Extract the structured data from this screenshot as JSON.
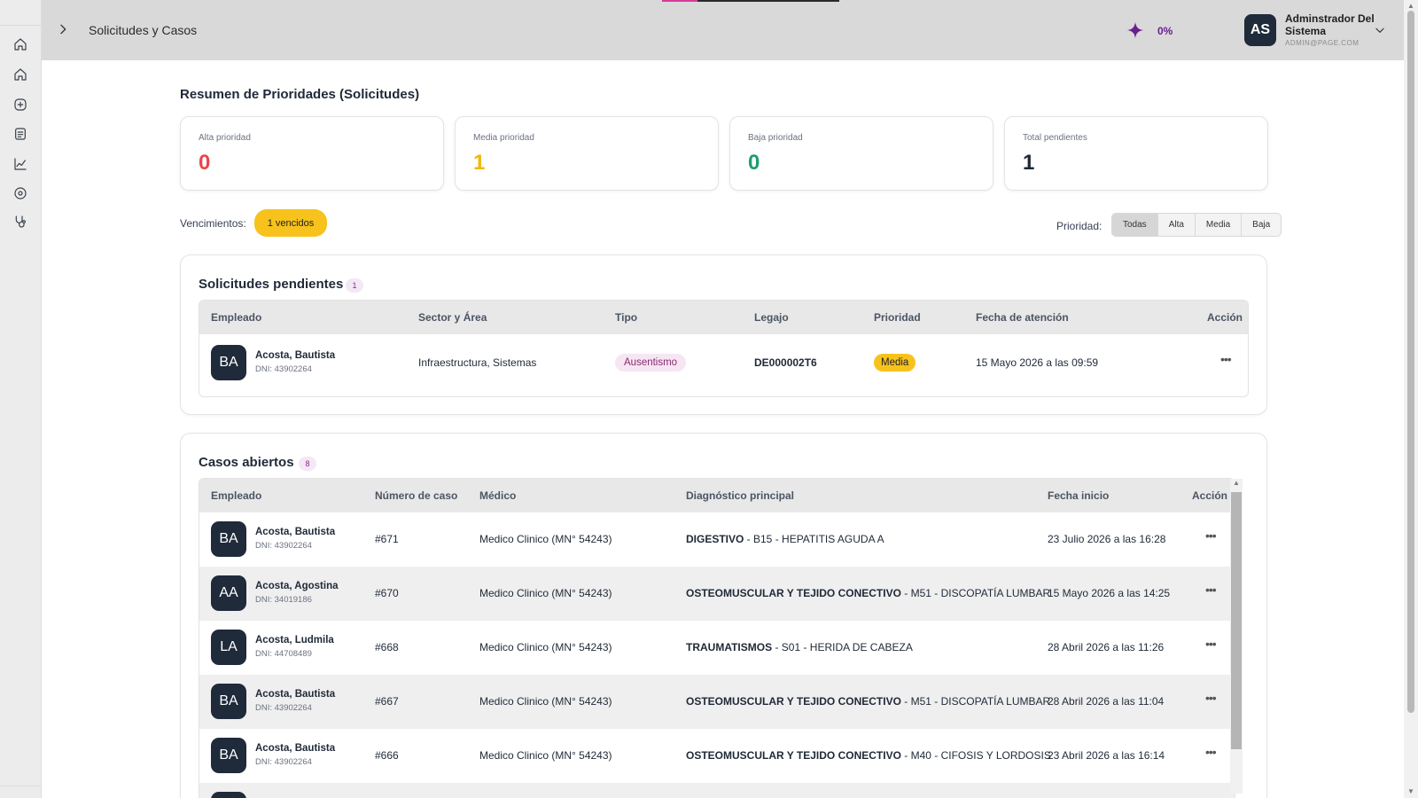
{
  "header": {
    "breadcrumb": "Solicitudes y Casos",
    "progress_percent": "0%",
    "user": {
      "initials": "AS",
      "name": "Adminstrador Del Sistema",
      "email": "ADMIN@PAGE.COM"
    }
  },
  "sidebar": {
    "icons": [
      "home-icon",
      "home-icon",
      "plus-circle-icon",
      "document-icon",
      "chart-icon",
      "target-icon",
      "stethoscope-icon"
    ]
  },
  "summary": {
    "title": "Resumen de Prioridades (Solicitudes)",
    "cards": [
      {
        "label": "Alta prioridad",
        "value": "0",
        "color": "#e8474c"
      },
      {
        "label": "Media prioridad",
        "value": "1",
        "color": "#f2b705"
      },
      {
        "label": "Baja prioridad",
        "value": "0",
        "color": "#1f9d6b"
      },
      {
        "label": "Total pendientes",
        "value": "1",
        "color": "#1f2937"
      }
    ]
  },
  "filters": {
    "vencimientos_label": "Vencimientos:",
    "vencimientos_badge": "1 vencidos",
    "prioridad_label": "Prioridad:",
    "prioridad_options": [
      "Todas",
      "Alta",
      "Media",
      "Baja"
    ],
    "prioridad_selected": "Todas"
  },
  "solicitudes": {
    "title": "Solicitudes pendientes",
    "count": "1",
    "columns": [
      "Empleado",
      "Sector y Área",
      "Tipo",
      "Legajo",
      "Prioridad",
      "Fecha de atención",
      "Acción"
    ],
    "rows": [
      {
        "initials": "BA",
        "name": "Acosta, Bautista",
        "dni": "DNI: 43902264",
        "sector": "Infraestructura, Sistemas",
        "tipo": "Ausentismo",
        "legajo": "DE000002T6",
        "prioridad": "Media",
        "fecha": "15 Mayo 2026 a las 09:59",
        "accion": "•••"
      }
    ]
  },
  "casos": {
    "title": "Casos abiertos",
    "count": "8",
    "columns": [
      "Empleado",
      "Número de caso",
      "Médico",
      "Diagnóstico principal",
      "Fecha inicio",
      "Acción"
    ],
    "rows": [
      {
        "initials": "BA",
        "name": "Acosta, Bautista",
        "dni": "DNI: 43902264",
        "numero": "#671",
        "medico": "Medico Clinico (MN° 54243)",
        "diag_cat": "DIGESTIVO",
        "diag_det": " - B15 - HEPATITIS AGUDA A",
        "fecha": "23 Julio 2026 a las 16:28",
        "accion": "•••"
      },
      {
        "initials": "AA",
        "name": "Acosta, Agostina",
        "dni": "DNI: 34019186",
        "numero": "#670",
        "medico": "Medico Clinico (MN° 54243)",
        "diag_cat": "OSTEOMUSCULAR Y TEJIDO CONECTIVO",
        "diag_det": " - M51 - DISCOPATÍA LUMBAR",
        "fecha": "15 Mayo 2026 a las 14:25",
        "accion": "•••"
      },
      {
        "initials": "LA",
        "name": "Acosta, Ludmila",
        "dni": "DNI: 44708489",
        "numero": "#668",
        "medico": "Medico Clinico (MN° 54243)",
        "diag_cat": "TRAUMATISMOS",
        "diag_det": " - S01 - HERIDA DE CABEZA",
        "fecha": "28 Abril 2026 a las 11:26",
        "accion": "•••"
      },
      {
        "initials": "BA",
        "name": "Acosta, Bautista",
        "dni": "DNI: 43902264",
        "numero": "#667",
        "medico": "Medico Clinico (MN° 54243)",
        "diag_cat": "OSTEOMUSCULAR Y TEJIDO CONECTIVO",
        "diag_det": " - M51 - DISCOPATÍA LUMBAR",
        "fecha": "28 Abril 2026 a las 11:04",
        "accion": "•••"
      },
      {
        "initials": "BA",
        "name": "Acosta, Bautista",
        "dni": "DNI: 43902264",
        "numero": "#666",
        "medico": "Medico Clinico (MN° 54243)",
        "diag_cat": "OSTEOMUSCULAR Y TEJIDO CONECTIVO",
        "diag_det": " - M40 - CIFOSIS Y LORDOSIS",
        "fecha": "23 Abril 2026 a las 16:14",
        "accion": "•••"
      }
    ]
  }
}
